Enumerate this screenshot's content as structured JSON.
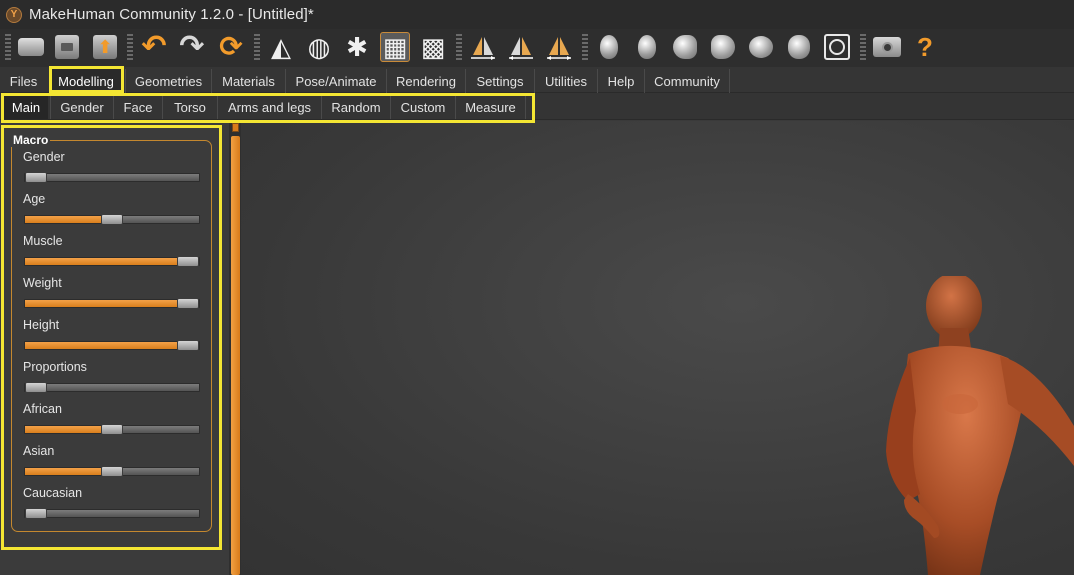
{
  "window": {
    "title": "MakeHuman Community 1.2.0 - [Untitled]*",
    "logo_glyph": "Y"
  },
  "toolbar": {
    "buttons": [
      {
        "name": "load-icon",
        "glyph": "▭"
      },
      {
        "name": "save-icon",
        "glyph": "▣"
      },
      {
        "name": "export-icon",
        "glyph": "⇧"
      },
      {
        "name": "undo-icon",
        "glyph": "↶"
      },
      {
        "name": "redo-icon",
        "glyph": "↷"
      },
      {
        "name": "reset-icon",
        "glyph": "⟳"
      },
      {
        "name": "smooth-icon",
        "glyph": "◭"
      },
      {
        "name": "wireframe-icon",
        "glyph": "◍"
      },
      {
        "name": "pose-icon",
        "glyph": "✱"
      },
      {
        "name": "grid-icon",
        "glyph": "▦"
      },
      {
        "name": "checker-icon",
        "glyph": "▩"
      },
      {
        "name": "symmetry-right-icon",
        "glyph": "⊿"
      },
      {
        "name": "symmetry-left-icon",
        "glyph": "◺"
      },
      {
        "name": "symmetry-icon",
        "glyph": "△"
      },
      {
        "name": "front-view-icon",
        "glyph": ""
      },
      {
        "name": "back-view-icon",
        "glyph": ""
      },
      {
        "name": "left-view-icon",
        "glyph": ""
      },
      {
        "name": "right-view-icon",
        "glyph": ""
      },
      {
        "name": "top-view-icon",
        "glyph": ""
      },
      {
        "name": "bottom-view-icon",
        "glyph": ""
      },
      {
        "name": "reset-camera-icon",
        "glyph": "◯"
      },
      {
        "name": "screenshot-icon",
        "glyph": "📷"
      },
      {
        "name": "help-icon",
        "glyph": "?"
      }
    ]
  },
  "main_tabs": [
    {
      "label": "Files"
    },
    {
      "label": "Modelling"
    },
    {
      "label": "Geometries"
    },
    {
      "label": "Materials"
    },
    {
      "label": "Pose/Animate"
    },
    {
      "label": "Rendering"
    },
    {
      "label": "Settings"
    },
    {
      "label": "Utilities"
    },
    {
      "label": "Help"
    },
    {
      "label": "Community"
    }
  ],
  "sub_tabs": [
    {
      "label": "Main"
    },
    {
      "label": "Gender"
    },
    {
      "label": "Face"
    },
    {
      "label": "Torso"
    },
    {
      "label": "Arms and legs"
    },
    {
      "label": "Random"
    },
    {
      "label": "Custom"
    },
    {
      "label": "Measure"
    }
  ],
  "macro_panel": {
    "title": "Macro",
    "sliders": [
      {
        "label": "Gender",
        "value": 0.0
      },
      {
        "label": "Age",
        "value": 0.5
      },
      {
        "label": "Muscle",
        "value": 1.0
      },
      {
        "label": "Weight",
        "value": 1.0
      },
      {
        "label": "Height",
        "value": 1.0
      },
      {
        "label": "Proportions",
        "value": 0.0
      },
      {
        "label": "African",
        "value": 0.5
      },
      {
        "label": "Asian",
        "value": 0.5
      },
      {
        "label": "Caucasian",
        "value": 0.0
      }
    ]
  },
  "colors": {
    "accent": "#f29b2b",
    "highlight": "#f4e633",
    "background": "#3a3a3a",
    "skin": "#b5582f"
  }
}
